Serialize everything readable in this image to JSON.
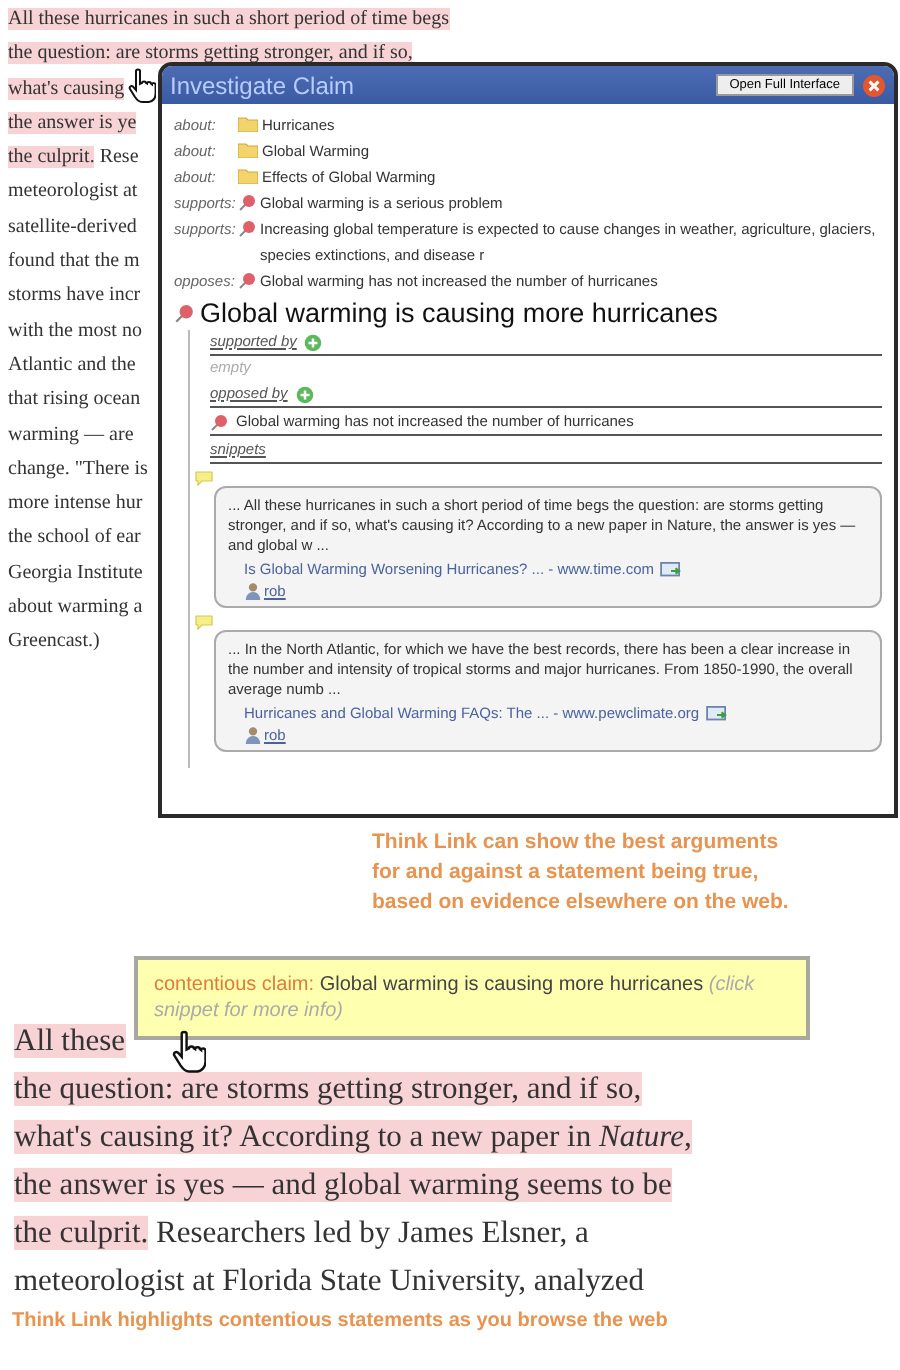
{
  "article_top": {
    "lines": [
      {
        "highlighted": "All these hurricanes in such a short period of time begs"
      },
      {
        "highlighted": "the question: are storms getting stronger, and if so,"
      },
      {
        "highlighted": "what's causing"
      },
      {
        "highlighted": "the answer is ye"
      },
      {
        "highlighted": "the culprit.",
        "text": "Rese"
      },
      {
        "text": "meteorologist at"
      },
      {
        "text": "satellite-derived"
      },
      {
        "text": "found that the m"
      },
      {
        "text": "storms have incr"
      },
      {
        "text": "with the most no"
      },
      {
        "text": "Atlantic and the"
      },
      {
        "text": "that rising ocean"
      },
      {
        "text": "warming — are"
      },
      {
        "text": "change. \"There is"
      },
      {
        "text": "more intense hur"
      },
      {
        "text": "the school of ear"
      },
      {
        "text": "Georgia Institute"
      },
      {
        "text": "about warming a"
      },
      {
        "text": "Greencast.)"
      }
    ]
  },
  "popup": {
    "title": "Investigate Claim",
    "open_button": "Open Full Interface",
    "links": [
      {
        "relation": "about:",
        "kind": "topic",
        "text": "Hurricanes"
      },
      {
        "relation": "about:",
        "kind": "topic",
        "text": "Global Warming"
      },
      {
        "relation": "about:",
        "kind": "topic",
        "text": "Effects of Global Warming"
      },
      {
        "relation": "supports:",
        "kind": "claim",
        "text": "Global warming is a serious problem"
      },
      {
        "relation": "supports:",
        "kind": "claim",
        "text": "Increasing global temperature is expected to cause changes in weather, agriculture, glaciers, species extinctions, and disease r"
      },
      {
        "relation": "opposes:",
        "kind": "claim",
        "text": "Global warming has not increased the number of hurricanes"
      }
    ],
    "claim": "Global warming is causing more hurricanes",
    "sections": [
      {
        "kind": "header",
        "label": "supported by"
      },
      {
        "kind": "empty",
        "label": "empty"
      },
      {
        "kind": "header",
        "label": "opposed by"
      },
      {
        "kind": "claim",
        "label": "Global warming has not increased the number of hurricanes"
      },
      {
        "kind": "label",
        "label": "snippets"
      }
    ],
    "snippets": [
      {
        "text": "... All these hurricanes in such a short period of time begs the question: are storms getting stronger, and if so, what's causing it? According to a new paper in Nature, the answer is yes — and global w ...",
        "link": "Is Global Warming Worsening Hurricanes? ... - www.time.com",
        "user": "rob"
      },
      {
        "text": "... In the North Atlantic, for which we have the best records, there has been a clear increase in the number and intensity of tropical storms and major hurricanes. From 1850-1990, the overall average numb ...",
        "link": "Hurricanes and Global Warming FAQs: The ... - www.pewclimate.org",
        "user": "rob"
      }
    ]
  },
  "caption_top": "Think Link can show the best arguments\nfor and against a statement being true,\nbased on evidence elsewhere on the web.",
  "tooltip": {
    "label": "contentious claim:",
    "claim": "Global warming is causing more hurricanes",
    "hint": "(click snippet for more info)"
  },
  "article_bottom": {
    "lines": [
      {
        "highlighted": "All these"
      },
      {
        "highlighted": "the question: are storms getting stronger, and if so,"
      },
      {
        "highlighted": "what's causing it? According to a new paper in *Nature*,"
      },
      {
        "highlighted": "the answer is yes — and global warming seems to be"
      },
      {
        "highlighted": "the culprit.",
        "text": "Researchers led by James Elsner, a"
      },
      {
        "text": "meteorologist at Florida State University, analyzed"
      }
    ]
  },
  "caption_bottom": "Think Link highlights contentious statements as you browse the web"
}
